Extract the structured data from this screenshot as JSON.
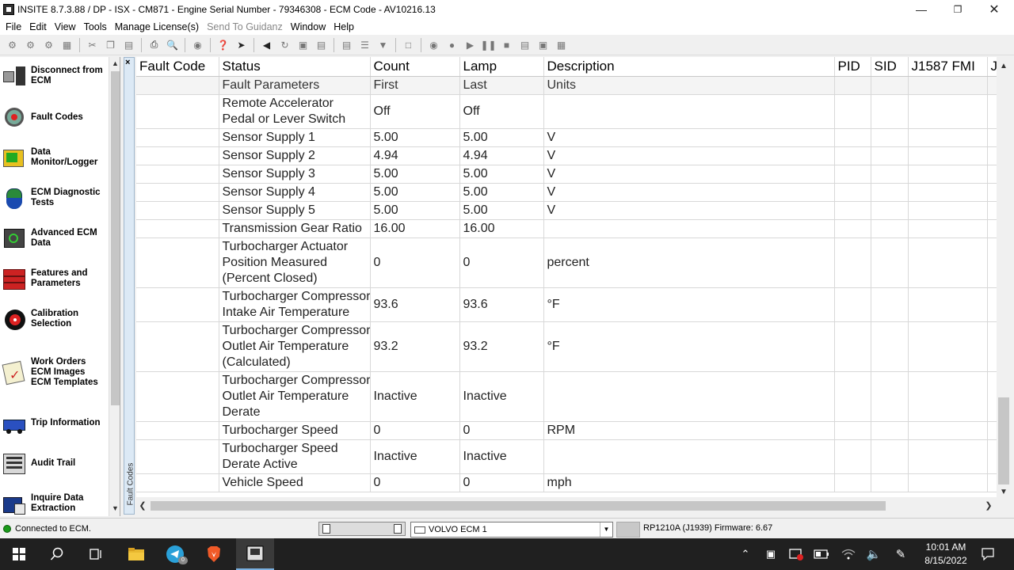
{
  "window": {
    "title": "INSITE 8.7.3.88  / DP - ISX - CM871 - Engine Serial Number - 79346308 - ECM Code - AV10216.13"
  },
  "menu": [
    "File",
    "Edit",
    "View",
    "Tools",
    "Manage License(s)",
    "Send To Guidanz",
    "Window",
    "Help"
  ],
  "sidebar": {
    "items": [
      {
        "label": "Disconnect from ECM",
        "icon": "disconnect-icon"
      },
      {
        "label": "Fault Codes",
        "icon": "fault-codes-icon"
      },
      {
        "label": "Data Monitor/Logger",
        "icon": "data-monitor-icon"
      },
      {
        "label": "ECM Diagnostic Tests",
        "icon": "diagnostic-tests-icon"
      },
      {
        "label": "Advanced ECM Data",
        "icon": "advanced-ecm-icon"
      },
      {
        "label": "Features and Parameters",
        "icon": "features-icon"
      },
      {
        "label": "Calibration Selection",
        "icon": "calibration-icon"
      },
      {
        "label": "Work Orders ECM Images ECM Templates",
        "icon": "work-orders-icon"
      },
      {
        "label": "Trip Information",
        "icon": "trip-info-icon"
      },
      {
        "label": "Audit Trail",
        "icon": "audit-trail-icon"
      },
      {
        "label": "Inquire Data Extraction",
        "icon": "inquire-data-icon"
      }
    ]
  },
  "panel_tab": {
    "label": "Fault Codes",
    "close": "×"
  },
  "grid": {
    "headers": [
      "Fault Code",
      "Status",
      "Count",
      "Lamp",
      "Description",
      "PID",
      "SID",
      "J1587 FMI",
      "J"
    ],
    "subheaders": [
      "",
      "Fault Parameters",
      "First",
      "Last",
      "Units",
      "",
      "",
      "",
      ""
    ],
    "rows": [
      {
        "param": "Remote Accelerator\nPedal or Lever Switch",
        "first": "Off",
        "last": "Off",
        "units": ""
      },
      {
        "param": "Sensor Supply 1",
        "first": "5.00",
        "last": "5.00",
        "units": "V"
      },
      {
        "param": "Sensor Supply 2",
        "first": "4.94",
        "last": "4.94",
        "units": "V"
      },
      {
        "param": "Sensor Supply 3",
        "first": "5.00",
        "last": "5.00",
        "units": "V"
      },
      {
        "param": "Sensor Supply 4",
        "first": "5.00",
        "last": "5.00",
        "units": "V"
      },
      {
        "param": "Sensor Supply 5",
        "first": "5.00",
        "last": "5.00",
        "units": "V"
      },
      {
        "param": "Transmission Gear Ratio",
        "first": "16.00",
        "last": "16.00",
        "units": ""
      },
      {
        "param": "Turbocharger Actuator\nPosition Measured\n(Percent Closed)",
        "first": "0",
        "last": "0",
        "units": "percent"
      },
      {
        "param": "Turbocharger Compressor\nIntake Air Temperature",
        "first": "93.6",
        "last": "93.6",
        "units": "°F"
      },
      {
        "param": "Turbocharger Compressor\nOutlet Air Temperature\n(Calculated)",
        "first": "93.2",
        "last": "93.2",
        "units": "°F"
      },
      {
        "param": "Turbocharger Compressor\nOutlet Air Temperature\nDerate",
        "first": "Inactive",
        "last": "Inactive",
        "units": ""
      },
      {
        "param": "Turbocharger Speed",
        "first": "0",
        "last": "0",
        "units": "RPM"
      },
      {
        "param": "Turbocharger Speed\nDerate Active",
        "first": "Inactive",
        "last": "Inactive",
        "units": ""
      },
      {
        "param": "Vehicle Speed",
        "first": "0",
        "last": "0",
        "units": "mph"
      }
    ]
  },
  "status": {
    "connection": "Connected to ECM.",
    "ecm_select": "VOLVO ECM 1",
    "adapter": "RP1210A (J1939)  Firmware: 6.67"
  },
  "taskbar": {
    "time": "10:01 AM",
    "date": "8/15/2022",
    "telegram_badge": "0"
  }
}
